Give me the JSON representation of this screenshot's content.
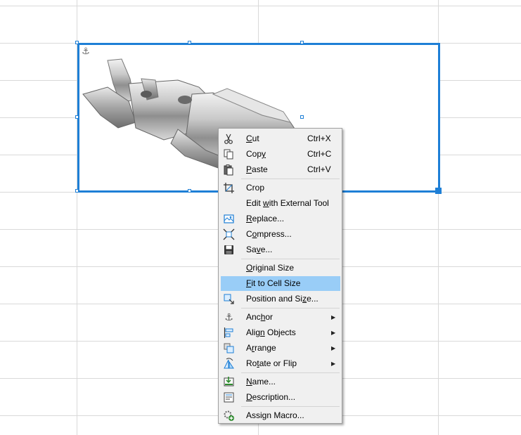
{
  "selected_image": {
    "subject": "metal crimp terminal (female spade connector)"
  },
  "context_menu": {
    "items": [
      {
        "label": "Cut",
        "mnemonic": "C",
        "shortcut": "Ctrl+X",
        "icon": "scissors-icon"
      },
      {
        "label": "Copy",
        "mnemonic": "y",
        "shortcut": "Ctrl+C",
        "icon": "copy-icon"
      },
      {
        "label": "Paste",
        "mnemonic": "P",
        "shortcut": "Ctrl+V",
        "icon": "paste-icon"
      },
      {
        "label": "Crop",
        "mnemonic": "",
        "icon": "crop-icon"
      },
      {
        "label": "Edit with External Tool",
        "mnemonic": "w",
        "icon": ""
      },
      {
        "label": "Replace...",
        "mnemonic": "R",
        "icon": "replace-icon"
      },
      {
        "label": "Compress...",
        "mnemonic": "o",
        "icon": "compress-icon"
      },
      {
        "label": "Save...",
        "mnemonic": "v",
        "icon": "save-icon"
      },
      {
        "label": "Original Size",
        "mnemonic": "O",
        "icon": ""
      },
      {
        "label": "Fit to Cell Size",
        "mnemonic": "F",
        "icon": "",
        "highlighted": true
      },
      {
        "label": "Position and Size...",
        "mnemonic": "z",
        "icon": "position-size-icon"
      },
      {
        "label": "Anchor",
        "mnemonic": "h",
        "submenu": true,
        "icon": "anchor-icon"
      },
      {
        "label": "Align Objects",
        "mnemonic": "n",
        "submenu": true,
        "icon": "align-icon"
      },
      {
        "label": "Arrange",
        "mnemonic": "r",
        "submenu": true,
        "icon": "arrange-icon"
      },
      {
        "label": "Rotate or Flip",
        "mnemonic": "t",
        "submenu": true,
        "icon": "rotate-flip-icon"
      },
      {
        "label": "Name...",
        "mnemonic": "N",
        "icon": "name-icon"
      },
      {
        "label": "Description...",
        "mnemonic": "D",
        "icon": "description-icon"
      },
      {
        "label": "Assign Macro...",
        "mnemonic": "",
        "icon": "assign-macro-icon"
      }
    ]
  },
  "colors": {
    "selection_border": "#1e7fd6",
    "menu_highlight": "#99cdf7",
    "menu_background": "#f0f0f0",
    "grid_line": "#d9d9d9"
  }
}
